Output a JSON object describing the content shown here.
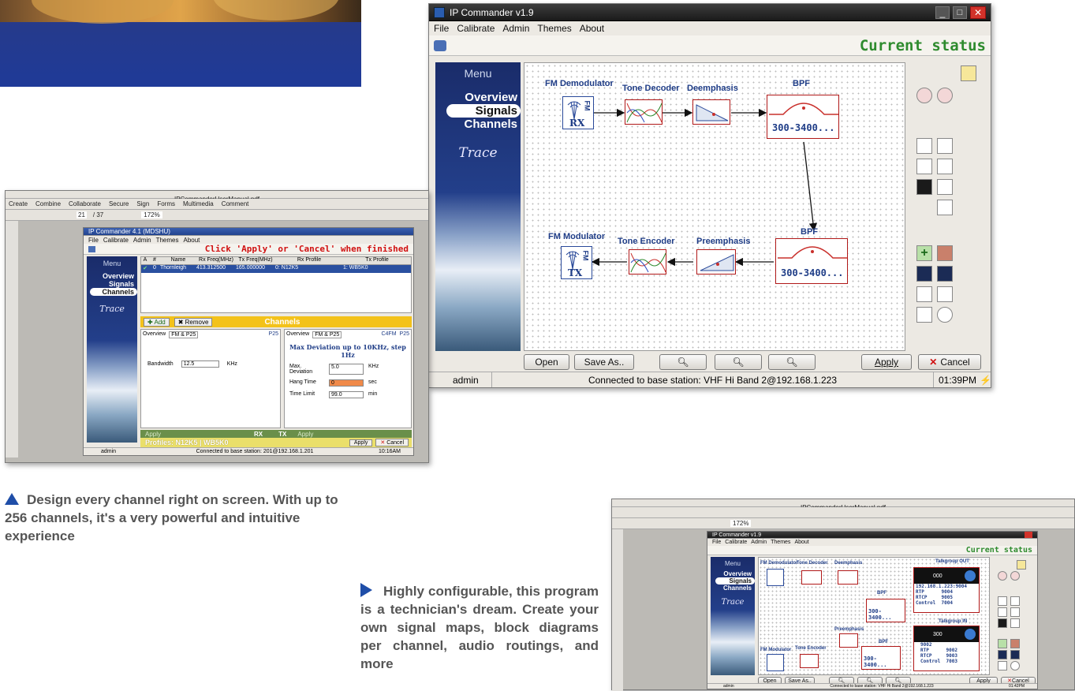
{
  "main_window": {
    "title": "IP Commander v1.9",
    "menu": [
      "File",
      "Calibrate",
      "Admin",
      "Themes",
      "About"
    ],
    "status_title": "Current status",
    "sidebar": {
      "menu_title": "Menu",
      "items": [
        "Overview",
        "Signals",
        "Channels"
      ],
      "active": "Signals",
      "trace": "Trace"
    },
    "blocks": {
      "fm_demod": "FM Demodulator",
      "tone_decoder": "Tone Decoder",
      "deemphasis": "Deemphasis",
      "bpf_top": "BPF",
      "bpf_top_range": "300-3400...",
      "fm_mod": "FM Modulator",
      "tone_encoder": "Tone Encoder",
      "preemphasis": "Preemphasis",
      "bpf_bottom": "BPF",
      "bpf_bottom_range": "300-3400...",
      "rx": "RX",
      "tx": "TX",
      "fm": "FM"
    },
    "buttons": {
      "open": "Open",
      "save_as": "Save As..",
      "apply": "Apply",
      "cancel": "Cancel"
    },
    "statusbar": {
      "user": "admin",
      "connection": "Connected to base station: VHF Hi Band 2@192.168.1.223",
      "time": "01:39PM"
    }
  },
  "left_window": {
    "pdf_title": "IPCommanderUserManual.pdf",
    "toolbar_items": [
      "Create",
      "Combine",
      "Collaborate",
      "Secure",
      "Sign",
      "Forms",
      "Multimedia",
      "Comment"
    ],
    "page": "21",
    "pages": "/ 37",
    "zoom": "172%",
    "app_title": "IP Commander 4.1 (MDSHU)",
    "menu": [
      "File",
      "Calibrate",
      "Admin",
      "Themes",
      "About"
    ],
    "status_title": "Click 'Apply' or 'Cancel' when finished",
    "sidebar": {
      "menu_title": "Menu",
      "items": [
        "Overview",
        "Signals",
        "Channels"
      ],
      "active": "Channels",
      "trace": "Trace"
    },
    "table": {
      "headers": [
        "A",
        "#",
        "Name",
        "Rx Freq(MHz)",
        "Tx Freq(MHz)",
        "Rx Profile",
        "Tx Profile"
      ],
      "row": [
        "✔",
        "0",
        "Thornleigh",
        "413.312500",
        "165.000000",
        "0: N12K5",
        "1: WB5K0"
      ]
    },
    "add": "Add",
    "remove": "Remove",
    "channels": "Channels",
    "rx_tabs": [
      "Overview",
      "FM & P25",
      "P25"
    ],
    "tx_tabs": [
      "Overview",
      "FM & P25",
      "C4FM",
      "P25"
    ],
    "bandwidth_label": "Bandwidth",
    "bandwidth_value": "12.5",
    "bandwidth_unit": "KHz",
    "max_dev_title": "Max Deviation up to 10KHz, step 1Hz",
    "fields": [
      {
        "label": "Max. Deviation",
        "value": "5.0",
        "unit": "KHz"
      },
      {
        "label": "Hang Time",
        "value": "0",
        "unit": "sec"
      },
      {
        "label": "Time Limit",
        "value": "99.0",
        "unit": "min"
      }
    ],
    "rx": "RX",
    "tx": "TX",
    "apply_small": "Apply",
    "profiles": "Profiles: N12K5 | WB5K0",
    "apply": "Apply",
    "cancel": "Cancel",
    "statusbar": {
      "user": "admin",
      "connection": "Connected to base station: 201@192.168.1.201",
      "time": "10:16AM"
    }
  },
  "right_window": {
    "pdf_title": "IPCommanderUserManual.pdf",
    "zoom": "172%",
    "app_title": "IP Commander v1.9",
    "menu": [
      "File",
      "Calibrate",
      "Admin",
      "Themes",
      "About"
    ],
    "status_title": "Current status",
    "sidebar": {
      "menu_title": "Menu",
      "items": [
        "Overview",
        "Signals",
        "Channels"
      ],
      "active": "Signals",
      "trace": "Trace"
    },
    "blocks": {
      "fm_demod": "FM Demodulator",
      "tone_decoder": "Tone Decoder",
      "deemphasis": "Deemphasis",
      "bpf": "BPF",
      "range": "300-3400...",
      "fm_mod": "FM Modulator",
      "tone_encoder": "Tone Encoder",
      "preemphasis": "Preemphasis"
    },
    "talkgroup_out": {
      "title": "Talkgroup OUT",
      "badge": "000",
      "lines": [
        "192.168.1.223:9004",
        "RTP      9004",
        "RTCP     9005",
        "Control  7004"
      ]
    },
    "talkgroup_in": {
      "title": "Talkgroup IN",
      "badge": "300",
      "lines": [
        "9002",
        "RTP      9002",
        "RTCP     9003",
        "Control  7003"
      ]
    },
    "buttons": {
      "open": "Open",
      "save_as": "Save As..",
      "apply": "Apply",
      "cancel": "Cancel"
    },
    "statusbar": {
      "user": "admin",
      "connection": "Connected to base station: VHF Hi Band 2@192.168.1.223",
      "time": "01:42PM"
    }
  },
  "captions": {
    "left": "Design every channel right on screen. With up to 256 channels, it's a very powerful and intuitive experience",
    "middle": "Highly configurable, this program is a technician's dream. Create your own signal maps, block diagrams per channel, audio routings, and more"
  },
  "colors": {
    "accent_blue": "#1f4ea8",
    "status_green": "#2e8b2e",
    "block_red": "#b01818",
    "label_blue": "#1f3d87",
    "warning_red": "#d01010",
    "highlight_yellow": "#f3c21a"
  }
}
